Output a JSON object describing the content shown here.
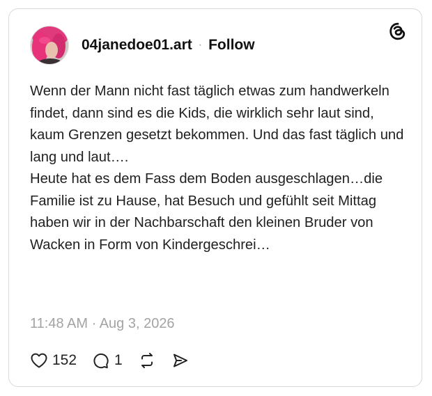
{
  "post": {
    "username": "04janedoe01.art",
    "separator": "·",
    "follow_label": "Follow",
    "paragraphs": [
      "Wenn der Mann nicht fast täglich etwas zum handwerkeln findet, dann sind es die Kids, die wirklich sehr laut sind, kaum Grenzen gesetzt bekommen. Und das fast täglich und lang und laut….",
      "Heute hat es dem Fass dem Boden ausgeschlagen…die Familie ist zu Hause, hat Besuch und gefühlt seit Mittag haben wir in der Nachbarschaft den kleinen Bruder von Wacken in Form von Kindergeschrei…"
    ],
    "timestamp": "11:48 AM · Aug 3, 2026"
  },
  "actions": {
    "likes_count": "152",
    "replies_count": "1"
  },
  "icons": {
    "like": "heart-icon",
    "reply": "comment-icon",
    "repost": "repost-icon",
    "share": "send-icon",
    "brand": "threads-logo-icon"
  },
  "colors": {
    "text": "#1f1f1f",
    "muted": "#a3a3a3",
    "border": "#d9d9d9",
    "avatar_hair": "#e8327a"
  }
}
